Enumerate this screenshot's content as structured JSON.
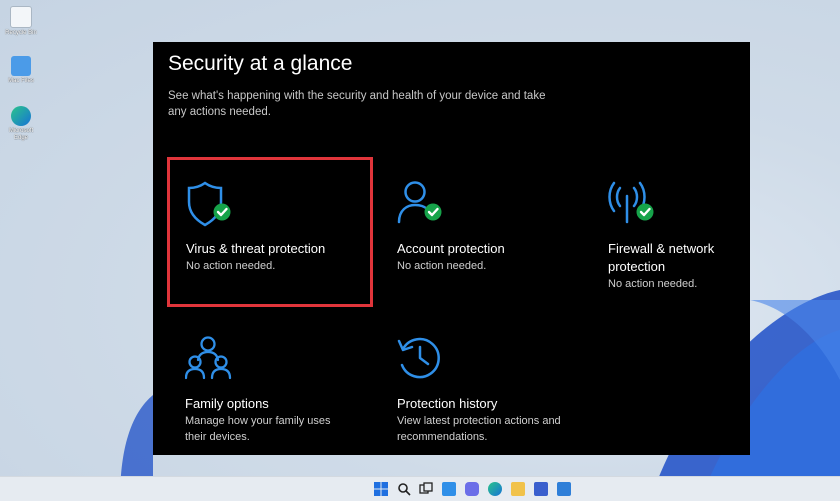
{
  "desktop": {
    "icons": [
      {
        "label": "Recycle Bin",
        "icon": "recycle-bin-icon"
      },
      {
        "label": "Mac Files",
        "icon": "folder-icon"
      },
      {
        "label": "Microsoft Edge",
        "icon": "edge-icon"
      }
    ]
  },
  "security": {
    "title": "Security at a glance",
    "subtitle": "See what's happening with the security and health of your device and take any actions needed.",
    "tiles": [
      {
        "icon": "shield-icon",
        "title": "Virus & threat protection",
        "status": "No action needed.",
        "ok": true
      },
      {
        "icon": "person-icon",
        "title": "Account protection",
        "status": "No action needed.",
        "ok": true
      },
      {
        "icon": "wireless-antenna-icon",
        "title": "Firewall & network protection",
        "status": "No action needed.",
        "ok": true
      },
      {
        "icon": "family-icon",
        "title": "Family options",
        "status": "Manage how your family uses their devices.",
        "ok": false
      },
      {
        "icon": "history-clock-icon",
        "title": "Protection history",
        "status": "View latest protection actions and recommendations.",
        "ok": false
      }
    ]
  },
  "colors": {
    "accent": "#2f8fe8",
    "check_green": "#16a34a",
    "highlight": "#e0353b",
    "panel_bg": "#000000"
  },
  "taskbar": {
    "icons": [
      "windows-start-icon",
      "search-icon",
      "task-view-icon",
      "widgets-icon",
      "chat-icon",
      "edge-icon",
      "file-explorer-icon",
      "store-icon",
      "mail-icon"
    ]
  }
}
